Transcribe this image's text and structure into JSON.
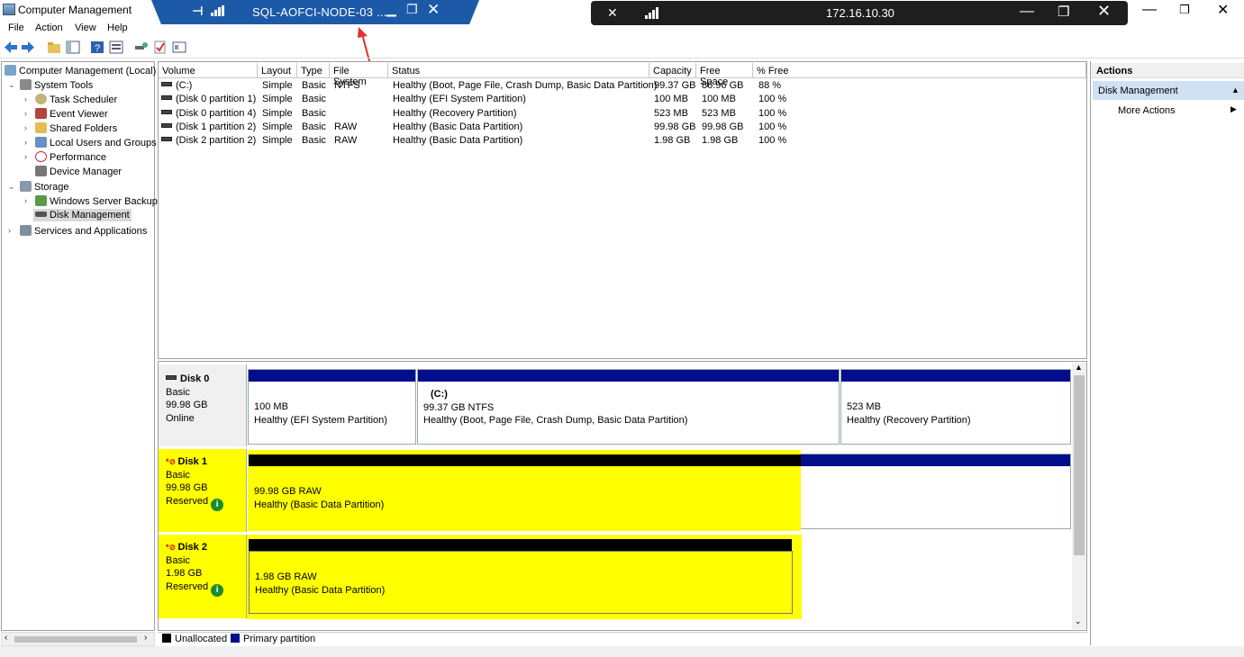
{
  "window": {
    "title": "Computer Management",
    "controls": {
      "min": "—",
      "max": "❐",
      "close": "✕"
    }
  },
  "rdp_bar": {
    "host": "SQL-AOFCI-NODE-03 ...",
    "pin": "⊣",
    "min": "▁",
    "restore": "❐",
    "close": "✕"
  },
  "remote_bar": {
    "address": "172.16.10.30",
    "pin": "✕",
    "min": "—",
    "restore": "❐",
    "close": "✕"
  },
  "menu": [
    "File",
    "Action",
    "View",
    "Help"
  ],
  "tree": {
    "root": "Computer Management (Local)",
    "system_tools": "System Tools",
    "task_scheduler": "Task Scheduler",
    "event_viewer": "Event Viewer",
    "shared_folders": "Shared Folders",
    "local_users": "Local Users and Groups",
    "performance": "Performance",
    "device_manager": "Device Manager",
    "storage": "Storage",
    "wsb": "Windows Server Backup",
    "disk_management": "Disk Management",
    "services": "Services and Applications"
  },
  "volume_table": {
    "headers": [
      "Volume",
      "Layout",
      "Type",
      "File System",
      "Status",
      "Capacity",
      "Free Space",
      "% Free"
    ],
    "rows": [
      [
        "(C:)",
        "Simple",
        "Basic",
        "NTFS",
        "Healthy (Boot, Page File, Crash Dump, Basic Data Partition)",
        "99.37 GB",
        "86.96 GB",
        "88 %"
      ],
      [
        "(Disk 0 partition 1)",
        "Simple",
        "Basic",
        "",
        "Healthy (EFI System Partition)",
        "100 MB",
        "100 MB",
        "100 %"
      ],
      [
        "(Disk 0 partition 4)",
        "Simple",
        "Basic",
        "",
        "Healthy (Recovery Partition)",
        "523 MB",
        "523 MB",
        "100 %"
      ],
      [
        "(Disk 1 partition 2)",
        "Simple",
        "Basic",
        "RAW",
        "Healthy (Basic Data Partition)",
        "99.98 GB",
        "99.98 GB",
        "100 %"
      ],
      [
        "(Disk 2 partition 2)",
        "Simple",
        "Basic",
        "RAW",
        "Healthy (Basic Data Partition)",
        "1.98 GB",
        "1.98 GB",
        "100 %"
      ]
    ]
  },
  "disks": {
    "disk0": {
      "name": "Disk 0",
      "type": "Basic",
      "size": "99.98 GB",
      "state": "Online",
      "p1": {
        "size": "100 MB",
        "status": "Healthy (EFI System Partition)"
      },
      "p2": {
        "label": "(C:)",
        "size": "99.37 GB NTFS",
        "status": "Healthy (Boot, Page File, Crash Dump, Basic Data Partition)"
      },
      "p3": {
        "size": "523 MB",
        "status": "Healthy (Recovery Partition)"
      }
    },
    "disk1": {
      "name": "Disk 1",
      "type": "Basic",
      "size": "99.98 GB",
      "state": "Reserved",
      "p1": {
        "size": "99.98 GB RAW",
        "status": "Healthy (Basic Data Partition)"
      }
    },
    "disk2": {
      "name": "Disk 2",
      "type": "Basic",
      "size": "1.98 GB",
      "state": "Reserved",
      "p1": {
        "size": "1.98 GB RAW",
        "status": "Healthy (Basic Data Partition)"
      }
    }
  },
  "legend": {
    "unallocated": "Unallocated",
    "primary": "Primary partition"
  },
  "actions": {
    "title": "Actions",
    "section": "Disk Management",
    "more": "More Actions"
  },
  "colors": {
    "primary": "#000e8c",
    "highlight": "#ffff00",
    "selection": "#cfe1f3",
    "rdp": "#1c5aa8"
  }
}
